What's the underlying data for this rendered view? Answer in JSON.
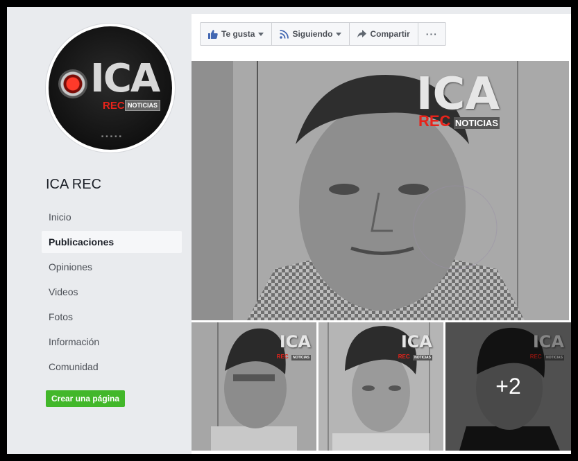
{
  "sidebar": {
    "avatar_logo": {
      "ica": "ICA",
      "rec": "REC",
      "noticias": "NOTICIAS"
    },
    "page_title": "ICA REC",
    "nav": [
      {
        "label": "Inicio",
        "active": false
      },
      {
        "label": "Publicaciones",
        "active": true
      },
      {
        "label": "Opiniones",
        "active": false
      },
      {
        "label": "Videos",
        "active": false
      },
      {
        "label": "Fotos",
        "active": false
      },
      {
        "label": "Información",
        "active": false
      },
      {
        "label": "Comunidad",
        "active": false
      }
    ],
    "create_page_label": "Crear una página"
  },
  "toolbar": {
    "like_label": "Te gusta",
    "following_label": "Siguiendo",
    "share_label": "Compartir",
    "more_label": "···"
  },
  "post": {
    "watermark": {
      "ica": "ICA",
      "rec": "REC",
      "noticias": "NOTICIAS"
    },
    "more_count": "+2"
  },
  "colors": {
    "page_bg": "#e9ebee",
    "brand_blue": "#4267b2",
    "create_green": "#42b72a",
    "rec_red": "#e8231a"
  },
  "icons": {
    "like": "thumbs-up-icon",
    "following": "rss-icon",
    "share": "share-arrow-icon",
    "record": "record-icon"
  }
}
